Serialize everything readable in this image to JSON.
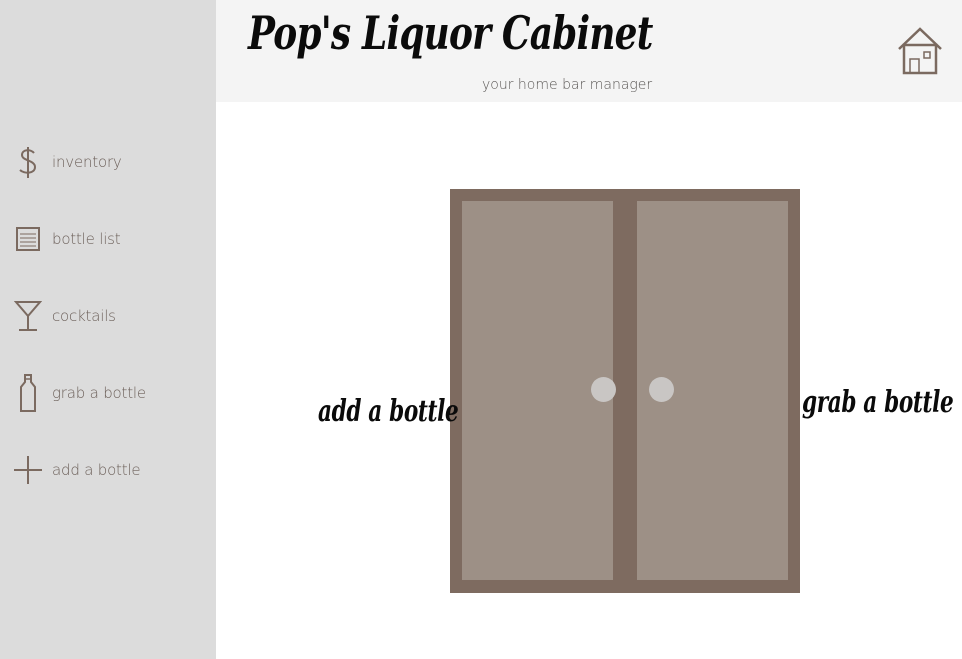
{
  "header": {
    "title": "Pop's Liquor Cabinet",
    "subtitle": "your home bar manager",
    "home_icon": "home-icon"
  },
  "sidebar": {
    "items": [
      {
        "label": "inventory",
        "icon": "dollar-icon"
      },
      {
        "label": "bottle list",
        "icon": "list-icon"
      },
      {
        "label": "cocktails",
        "icon": "martini-glass-icon"
      },
      {
        "label": "grab a bottle",
        "icon": "bottle-icon"
      },
      {
        "label": "add a bottle",
        "icon": "plus-icon"
      }
    ]
  },
  "main": {
    "left_door_label": "add a bottle",
    "right_door_label": "grab a bottle"
  },
  "colors": {
    "sidebar_bg": "#dcdcdc",
    "header_bg": "#f4f4f4",
    "cabinet_frame": "#7e6b60",
    "cabinet_door": "#9d9086",
    "knob": "#c9c6c4",
    "icon": "#7b6a60"
  }
}
